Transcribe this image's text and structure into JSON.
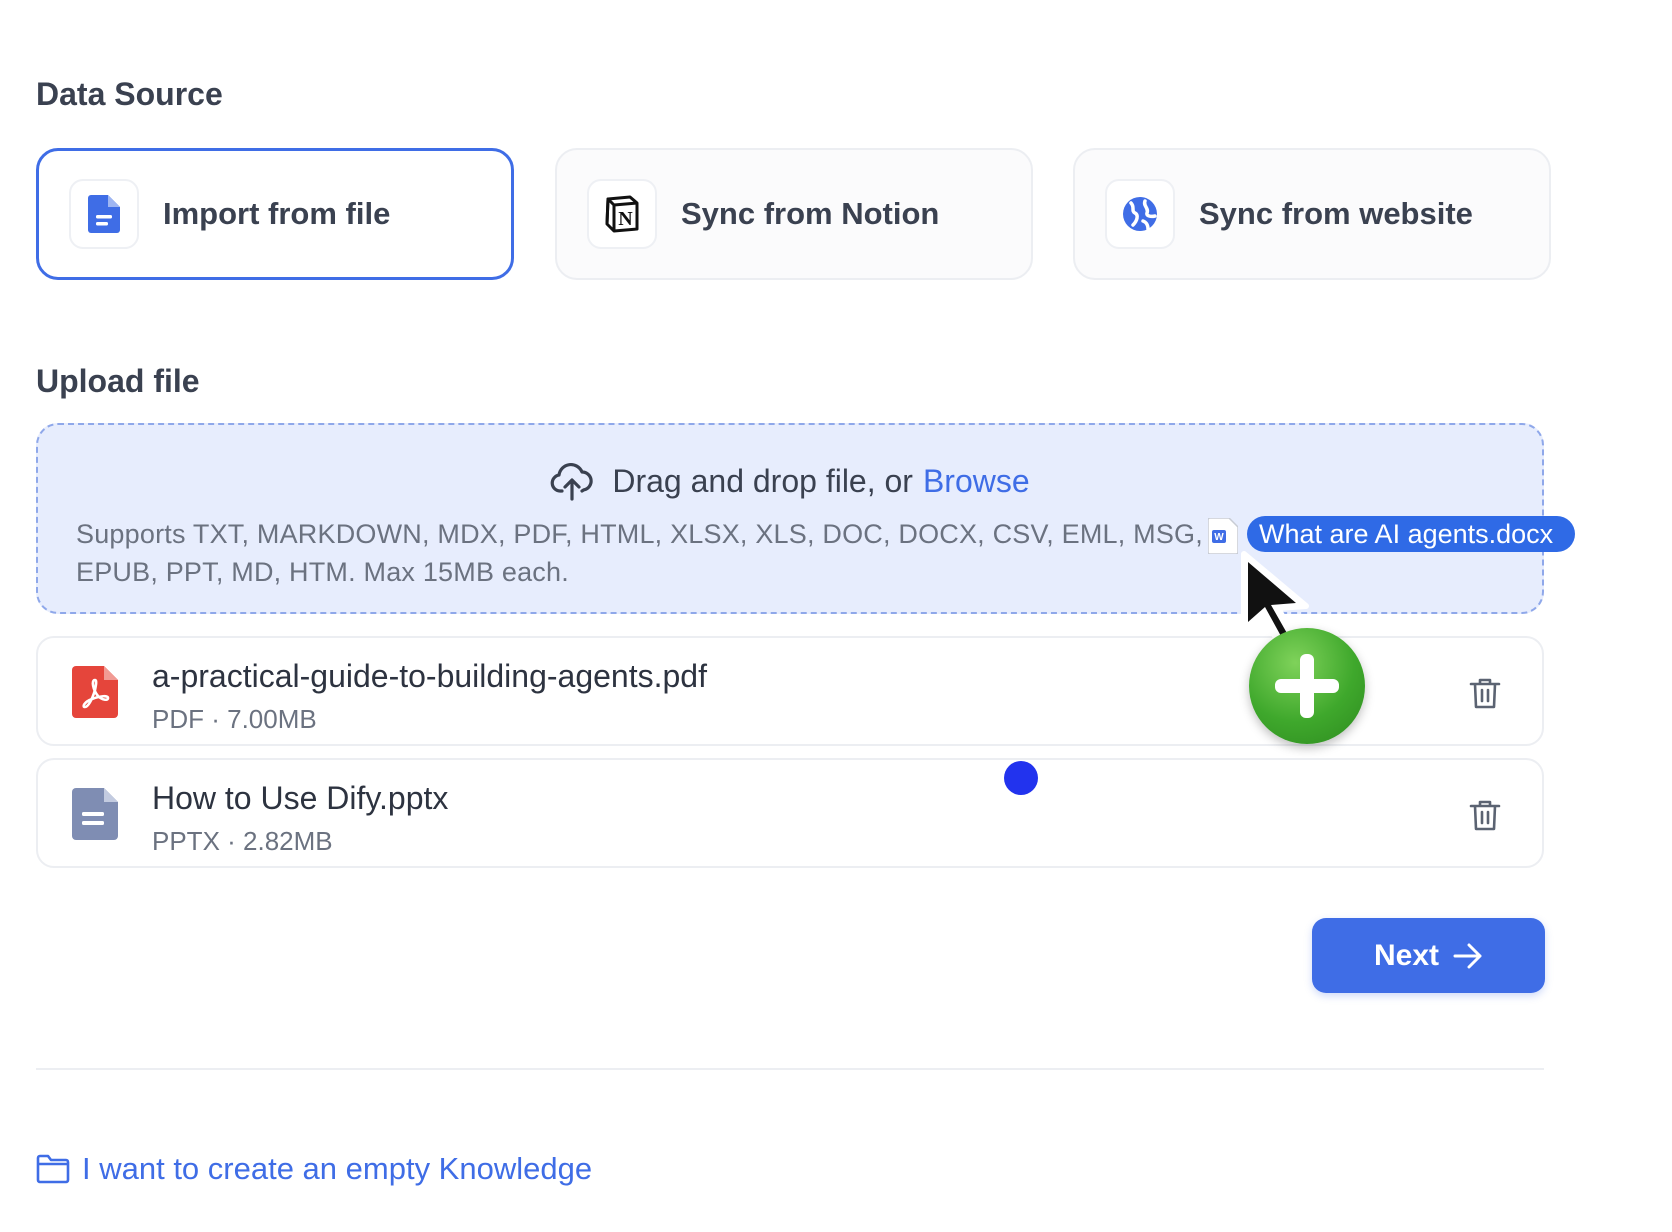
{
  "data_source": {
    "title": "Data Source",
    "options": [
      {
        "label": "Import from file",
        "icon": "file-icon",
        "selected": true
      },
      {
        "label": "Sync from Notion",
        "icon": "notion-icon",
        "selected": false
      },
      {
        "label": "Sync from website",
        "icon": "globe-icon",
        "selected": false
      }
    ]
  },
  "upload": {
    "title": "Upload file",
    "drop_text": "Drag and drop file, or",
    "browse_label": "Browse",
    "support_text": "Supports TXT, MARKDOWN, MDX, PDF, HTML, XLSX, XLS, DOC, DOCX, CSV, EML, MSG, EPUB, PPT, MD, HTM. Max 15MB each."
  },
  "files": [
    {
      "name": "a-practical-guide-to-building-agents.pdf",
      "type": "PDF",
      "size": "7.00MB",
      "icon": "pdf-icon"
    },
    {
      "name": "How to Use Dify.pptx",
      "type": "PPTX",
      "size": "2.82MB",
      "icon": "document-icon"
    }
  ],
  "meta_separator": " · ",
  "next_label": "Next",
  "empty_knowledge_label": "I want to create an empty Knowledge",
  "drag": {
    "file_name": "What are AI agents.docx"
  },
  "colors": {
    "accent": "#3f6de6",
    "pdf_red": "#e5453b",
    "plus_green": "#3fa82c"
  }
}
